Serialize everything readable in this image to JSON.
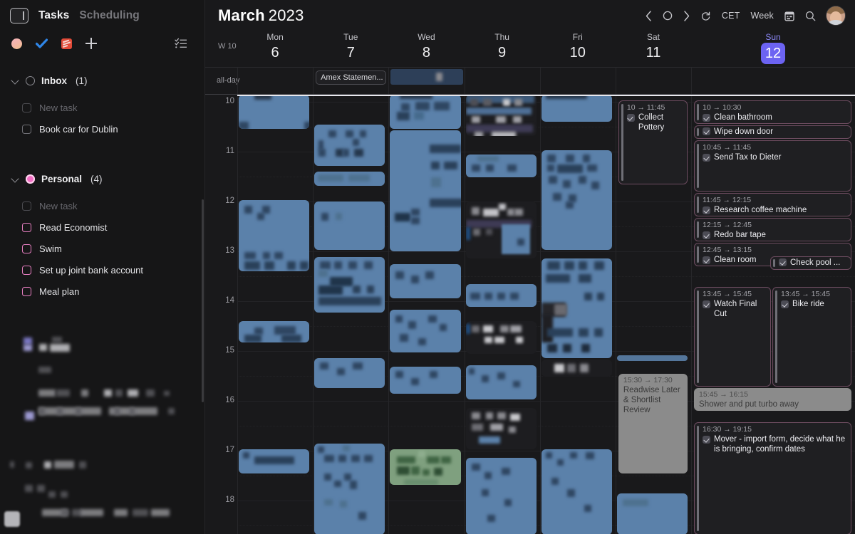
{
  "sidebar": {
    "app_icon": "panel-icon",
    "tabs": [
      {
        "label": "Tasks",
        "active": true
      },
      {
        "label": "Scheduling",
        "active": false
      }
    ],
    "toolbar": {
      "icons": [
        "profile-dot-icon",
        "check-icon",
        "todoist-icon",
        "plus-icon"
      ],
      "list_icon": "checklist-icon"
    },
    "groups": [
      {
        "name": "inbox",
        "title": "Inbox",
        "count": "(1)",
        "bullet": "hollow",
        "tasks": [
          {
            "label": "New task",
            "dim": true
          },
          {
            "label": "Book car for Dublin",
            "dim": false
          }
        ]
      },
      {
        "name": "personal",
        "title": "Personal",
        "count": "(4)",
        "bullet": "pink",
        "tasks": [
          {
            "label": "New task",
            "dim": true
          },
          {
            "label": "Read Economist",
            "dim": false
          },
          {
            "label": "Swim",
            "dim": false
          },
          {
            "label": "Set up joint bank account",
            "dim": false
          },
          {
            "label": "Meal plan",
            "dim": false
          }
        ]
      }
    ]
  },
  "header": {
    "month": "March",
    "year": "2023",
    "prev_icon": "chevron-left-icon",
    "today_icon": "today-circle-icon",
    "next_icon": "chevron-right-icon",
    "refresh_icon": "refresh-icon",
    "timezone": "CET",
    "view": "Week",
    "calendar_icon": "calendar-icon",
    "search_icon": "search-icon",
    "avatar": "user-avatar"
  },
  "week": {
    "week_label": "W 10",
    "allday_label": "all-day",
    "days": [
      {
        "dow": "Mon",
        "num": "6",
        "today": false
      },
      {
        "dow": "Tue",
        "num": "7",
        "today": false
      },
      {
        "dow": "Wed",
        "num": "8",
        "today": false
      },
      {
        "dow": "Thu",
        "num": "9",
        "today": false
      },
      {
        "dow": "Fri",
        "num": "10",
        "today": false
      },
      {
        "dow": "Sat",
        "num": "11",
        "today": false
      },
      {
        "dow": "Sun",
        "num": "12",
        "today": true
      }
    ],
    "allday_events": [
      {
        "day": 1,
        "label": "Amex Statemen...",
        "redacted": false
      },
      {
        "day": 2,
        "label": "",
        "redacted": true
      }
    ],
    "hours": [
      "10",
      "11",
      "12",
      "13",
      "14",
      "15",
      "16",
      "17",
      "18"
    ]
  },
  "events": {
    "saturday": [
      {
        "time": "10 → 11:45",
        "title": "Collect Pottery",
        "checkbox": true,
        "style": "task"
      },
      {
        "time": "15:30 → 17:30",
        "title": "Readwise Later & Shortlist Review",
        "checkbox": false,
        "style": "grey"
      }
    ],
    "sunday": [
      {
        "time": "10 → 10:30",
        "title": "Clean bathroom",
        "checkbox": true,
        "style": "task"
      },
      {
        "time": "",
        "title": "Wipe down door",
        "checkbox": true,
        "style": "task"
      },
      {
        "time": "10:45 → 11:45",
        "title": "Send Tax to Dieter",
        "checkbox": true,
        "style": "task"
      },
      {
        "time": "11:45 → 12:15",
        "title": "Research coffee machine",
        "checkbox": true,
        "style": "task"
      },
      {
        "time": "12:15 → 12:45",
        "title": "Redo bar tape",
        "checkbox": true,
        "style": "task"
      },
      {
        "time": "12:45 → 13:15",
        "title": "Clean room",
        "checkbox": true,
        "style": "task"
      },
      {
        "time": "",
        "title": "Check pool ...",
        "checkbox": true,
        "style": "task"
      },
      {
        "time": "13:45 → 15:45",
        "title": "Watch Final Cut",
        "checkbox": true,
        "style": "task"
      },
      {
        "time": "13:45 → 15:45",
        "title": "Bike ride",
        "checkbox": true,
        "style": "task"
      },
      {
        "time": "15:45 → 16:15",
        "title": "Shower and put turbo away",
        "checkbox": false,
        "style": "grey"
      },
      {
        "time": "16:30 → 19:15",
        "title": "Mover - import form, decide what he is bringing, confirm dates",
        "checkbox": true,
        "style": "task"
      }
    ]
  },
  "colors": {
    "accent": "#6c63f2",
    "task_border": "#6d4c60",
    "blurred_event": "#5b81aa",
    "blurred_event_green": "#7fa07f",
    "grey_event": "#8b8b8b",
    "personal_bullet": "#f26fc4",
    "background": "#19191b"
  }
}
